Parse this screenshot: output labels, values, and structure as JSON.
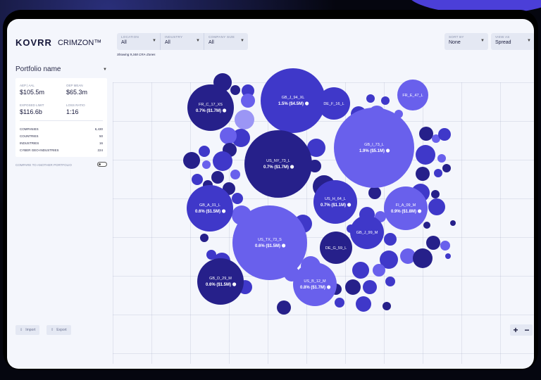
{
  "brand": {
    "logo": "KOVRR",
    "product": "CRIMZON™"
  },
  "filters": [
    {
      "label": "LOCATION",
      "value": "All"
    },
    {
      "label": "INDUSTRY",
      "value": "All"
    },
    {
      "label": "COMPANY SIZE",
      "value": "All"
    }
  ],
  "right_filters": [
    {
      "label": "SORT BY",
      "value": "None"
    },
    {
      "label": "VIEW AS",
      "value": "Spread"
    }
  ],
  "showing": "Showing 9,348 CRA-Zones",
  "portfolio": {
    "title": "Portfolio name",
    "metrics": [
      {
        "label": "AEP | AAL",
        "value": "$105.5m"
      },
      {
        "label": "OEP MEAN",
        "value": "$65.3m"
      },
      {
        "label": "EXPOSED LIMIT",
        "value": "$116.6b"
      },
      {
        "label": "LOSS RATIO",
        "value": "1:16"
      }
    ],
    "stats": [
      {
        "label": "COMPANIES",
        "value": "6,430"
      },
      {
        "label": "COUNTRIES",
        "value": "50"
      },
      {
        "label": "INDUSTRIES",
        "value": "16"
      },
      {
        "label": "CYBER GEO-INDUSTRIES",
        "value": "224"
      }
    ],
    "compare_label": "COMPARE TO ANOTHER PORTFOLIO"
  },
  "buttons": {
    "import": "Import",
    "export": "Export"
  },
  "zoom": {
    "in": "+",
    "out": "−"
  },
  "colors": {
    "dark": "#26208a",
    "mid": "#3f38c9",
    "light": "#6960ec",
    "pale": "#9b96f5"
  },
  "bubbles": [
    {
      "code": "GB_J_94_XL",
      "value": "1.5% ($4.5M)"
    },
    {
      "code": "FR_C_17_XS",
      "value": "0.7% ($1.7M)"
    },
    {
      "code": "DE_F_16_L",
      "value": ""
    },
    {
      "code": "FR_E_47_L",
      "value": ""
    },
    {
      "code": "GB_I_73_L",
      "value": "1.9% ($5.1M)"
    },
    {
      "code": "US_NY_73_L",
      "value": "0.7% ($1.7M)"
    },
    {
      "code": "GB_A_01_L",
      "value": "0.6% ($1.5M)"
    },
    {
      "code": "US_H_64_L",
      "value": "0.7% ($1.1M)"
    },
    {
      "code": "FI_A_09_M",
      "value": "0.9% ($1.8M)"
    },
    {
      "code": "GB_J_99_M",
      "value": ""
    },
    {
      "code": "US_TX_73_S",
      "value": "0.6% ($1.5M)"
    },
    {
      "code": "DE_G_59_L",
      "value": ""
    },
    {
      "code": "GB_D_29_M",
      "value": "0.6% ($1.5M)"
    },
    {
      "code": "US_B_12_M",
      "value": "0.8% ($1.7M)"
    }
  ]
}
